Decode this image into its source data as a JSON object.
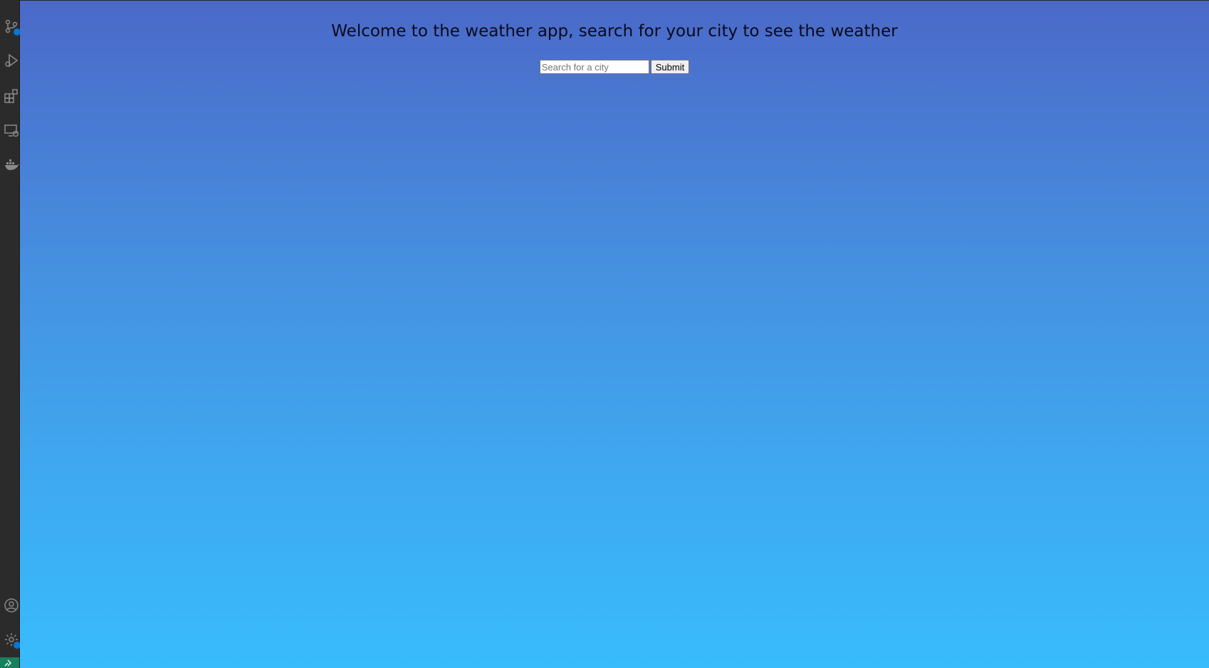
{
  "activity_bar": {
    "icons": [
      "source-control-icon",
      "run-debug-icon",
      "extensions-icon",
      "remote-explorer-icon",
      "docker-icon",
      "account-icon",
      "settings-gear-icon",
      "remote-status-icon"
    ]
  },
  "colors": {
    "gradient_top": "#4b69c8",
    "gradient_bottom": "#38bcfc",
    "activity_bar_bg": "#2b2b2b",
    "badge": "#0078d4",
    "remote_status": "#16825d"
  },
  "app": {
    "heading": "Welcome to the weather app, search for your city to see the weather",
    "search": {
      "placeholder": "Search for a city",
      "value": ""
    },
    "submit_label": "Submit"
  }
}
